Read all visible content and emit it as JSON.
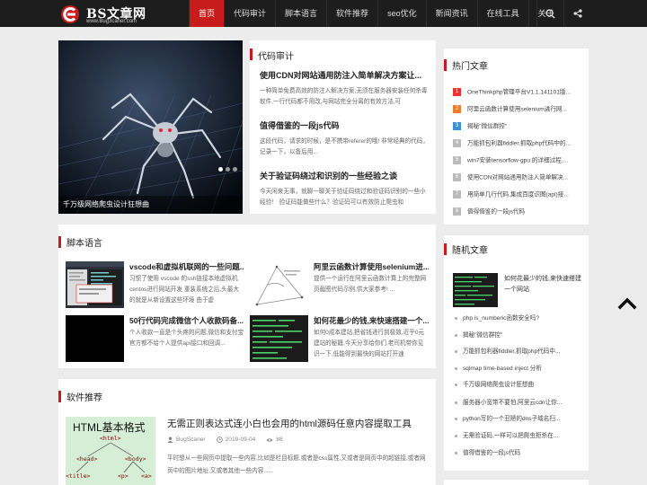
{
  "brand": {
    "title": "BS文章网",
    "subtitle": "www.Bug3caner.com",
    "accent": "#c81c1c"
  },
  "nav": {
    "items": [
      "首页",
      "代码审计",
      "脚本语言",
      "软件推荐",
      "seo优化",
      "新闻资讯",
      "在线工具",
      "关于"
    ],
    "active_index": 0,
    "icons": [
      "search-icon",
      "share-icon"
    ]
  },
  "slider": {
    "caption": "千万级网络爬虫设计狂想曲",
    "slides": 3,
    "active_slide": 0
  },
  "featured": {
    "section_title": "代码审计",
    "items": [
      {
        "title": "使用CDN对网站通用防注入简单解决方案让...",
        "desc": "一种简单免费高效的防注入解决方案,无须在服务器安装任何杀毒软件,一行代码都不用改,与网站完全分离的有效方法,可"
      },
      {
        "title": "值得借鉴的一段js代码",
        "desc": "这段代码，请求的时候，是不携带referer的哦! 非常经典的代码，记录一下，以备后用..."
      },
      {
        "title": "关于验证码绕过和识别的一些经验之谈",
        "desc": "今天闲来无事，就聊一聊关于验证码绕过和验证码识别的一些小经验！ 验证码能做些什么？验证码可以有效防止爬虫和"
      }
    ]
  },
  "scripts": {
    "section_title": "脚本语言",
    "items": [
      {
        "title": "vscode和虚拟机联网的一些问题...",
        "desc": "习惯了使用 vscode 的ssh链接本地虚拟机centos进行网站开发 重装系统之后,头最大的就是从新设置这些环境 由于虚"
      },
      {
        "title": "阿里云函数计算使用selenium进...",
        "desc": "提供一个运行在阿里云函数计算上的完整网页截图代码示例,供大家参考! ..."
      },
      {
        "title": "50行代码完成微信个人收款码备...",
        "desc": "个人收款一直是个头疼的问题,微信和支付宝官方都不给个人提供api接口和回调..."
      },
      {
        "title": "如何花最少的钱,来快速搭建一个...",
        "desc": "如何0成本建站,把省钱进行到极致,近乎0元建站的秘籍,今天分享给你们,老司机带你见识一下,低能得到最快的网站打开速"
      }
    ]
  },
  "software": {
    "section_title": "软件推荐",
    "thumb_label": "HTML基本格式",
    "tree_nodes": [
      "<html>",
      "<head>",
      "<body>",
      "<title>",
      "<p>",
      "<a>"
    ],
    "item": {
      "title": "无需正则表达式连小白也会用的html源码任意内容提取工具",
      "author": "BugScaner",
      "date": "2019-09-04",
      "views": "88",
      "desc": "平时想从一些网页中提取一些内容,比如是栏目标题,或者是css属性,又或者是网页中的超链接,或者网页中的图片地址,又或者其他一些内容......"
    }
  },
  "hot": {
    "section_title": "热门文章",
    "items": [
      "OneThinkphp管理平台V1.1.141101版...",
      "阿里云函数计算使用selenium进行网...",
      "揭秘\"微信群控\"",
      "万能抓包利器fiddler,抓取php代码中的...",
      "win7安装tensorflow-gpu 的详细过程,...",
      "使用CDN对网站通用防注入简单解决...",
      "用简单几行代码,集成百度识图(api)接...",
      "值得借鉴的一段js代码"
    ]
  },
  "random": {
    "section_title": "随机文章",
    "top": {
      "title": "如何花最少的钱,来快速搭建一个网站"
    },
    "items": [
      "php is_numberic函数安全吗?",
      "揭秘\"微信群控\"",
      "万能抓包利器fiddler,抓取php代码中...",
      "sqlmap time-based inject 分析",
      "千万级网络爬虫设计狂想曲",
      "服务器小宽带不要怕,阿里云cdn让你...",
      "python写的一个丑陋的dns子域名扫...",
      "无需验证码,一样可以把爬虫拒杀在...",
      "值得借鉴的一段js代码"
    ]
  }
}
